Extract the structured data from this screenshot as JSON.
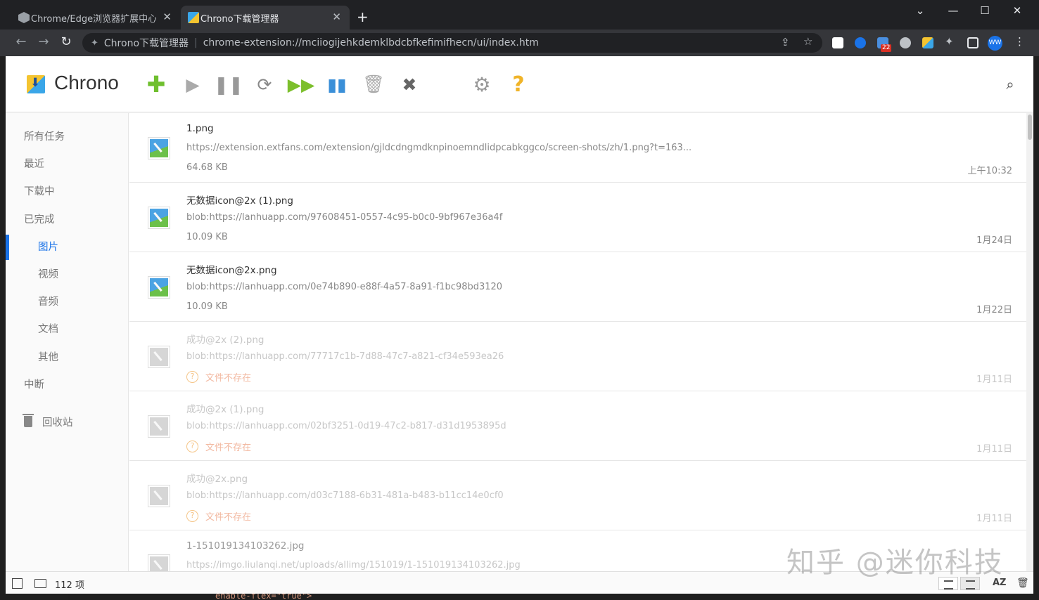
{
  "browser": {
    "tabs": [
      {
        "title": "Chrome/Edge浏览器扩展中心",
        "close": "✕",
        "active": false
      },
      {
        "title": "Chrono下载管理器",
        "close": "✕",
        "active": true
      }
    ],
    "new_tab": "+",
    "window_controls": {
      "minimize": "—",
      "maximize": "☐",
      "close": "✕",
      "tab_search": "⌄"
    },
    "nav": {
      "back": "←",
      "forward": "→",
      "reload": "↻"
    },
    "omnibox": {
      "page_title": "Chrono下载管理器",
      "separator": "|",
      "url": "chrome-extension://mciiogijehkdemklbdcbfkefimifhecn/ui/index.htm"
    },
    "omnibox_icons": {
      "share": "⇪",
      "bookmark": "☆"
    },
    "extension_badge": "22",
    "avatar": "WW",
    "menu": "⋮"
  },
  "app": {
    "title": "Chrono",
    "toolbar_glyphs": {
      "add": "✚",
      "start": "▶",
      "pause": "❚❚",
      "refresh": "⟳",
      "start_all": "▶▶",
      "pause_all": "▮▮",
      "trash": "🗑",
      "delete": "✖",
      "settings": "⚙",
      "help": "?",
      "search": "⌕"
    },
    "accent_color": "#1a73e8"
  },
  "sidebar": {
    "items": [
      {
        "label": "所有任务",
        "level": 1
      },
      {
        "label": "最近",
        "level": 1
      },
      {
        "label": "下载中",
        "level": 1
      },
      {
        "label": "已完成",
        "level": 1
      },
      {
        "label": "图片",
        "level": 2,
        "active": true
      },
      {
        "label": "视频",
        "level": 2
      },
      {
        "label": "音频",
        "level": 2
      },
      {
        "label": "文档",
        "level": 2
      },
      {
        "label": "其他",
        "level": 2
      },
      {
        "label": "中断",
        "level": 1
      }
    ],
    "recycle": {
      "label": "回收站",
      "icon": "trash-icon"
    }
  },
  "downloads": [
    {
      "name": "1.png",
      "url": "https://extension.extfans.com/extension/gjldcdngmdknpinoemndlidpcabkggco/screen-shots/zh/1.png?t=163...",
      "size": "64.68 KB",
      "date": "上午10:32",
      "missing": false
    },
    {
      "name": "无数据icon@2x (1).png",
      "url": "blob:https://lanhuapp.com/97608451-0557-4c95-b0c0-9bf967e36a4f",
      "size": "10.09 KB",
      "date": "1月24日",
      "missing": false
    },
    {
      "name": "无数据icon@2x.png",
      "url": "blob:https://lanhuapp.com/0e74b890-e88f-4a57-8a91-f1bc98bd3120",
      "size": "10.09 KB",
      "date": "1月22日",
      "missing": false
    },
    {
      "name": "成功@2x (2).png",
      "url": "blob:https://lanhuapp.com/77717c1b-7d88-47c7-a821-cf34e593ea26",
      "status": "文件不存在",
      "date": "1月11日",
      "missing": true
    },
    {
      "name": "成功@2x (1).png",
      "url": "blob:https://lanhuapp.com/02bf3251-0d19-47c2-b817-d31d1953895d",
      "status": "文件不存在",
      "date": "1月11日",
      "missing": true
    },
    {
      "name": "成功@2x.png",
      "url": "blob:https://lanhuapp.com/d03c7188-6b31-481a-b483-b11cc14e0cf0",
      "status": "文件不存在",
      "date": "1月11日",
      "missing": true
    },
    {
      "name": "1-151019134103262.jpg",
      "url": "https://imgo.liulanqi.net/uploads/allimg/151019/1-151019134103262.jpg",
      "status": "",
      "date": "",
      "missing": true
    }
  ],
  "statusbar": {
    "count": "112 项",
    "sort": "AZ",
    "delete": "🗑"
  },
  "watermark": "知乎 @迷你科技",
  "background_code": "enable-flex=\"true\">"
}
